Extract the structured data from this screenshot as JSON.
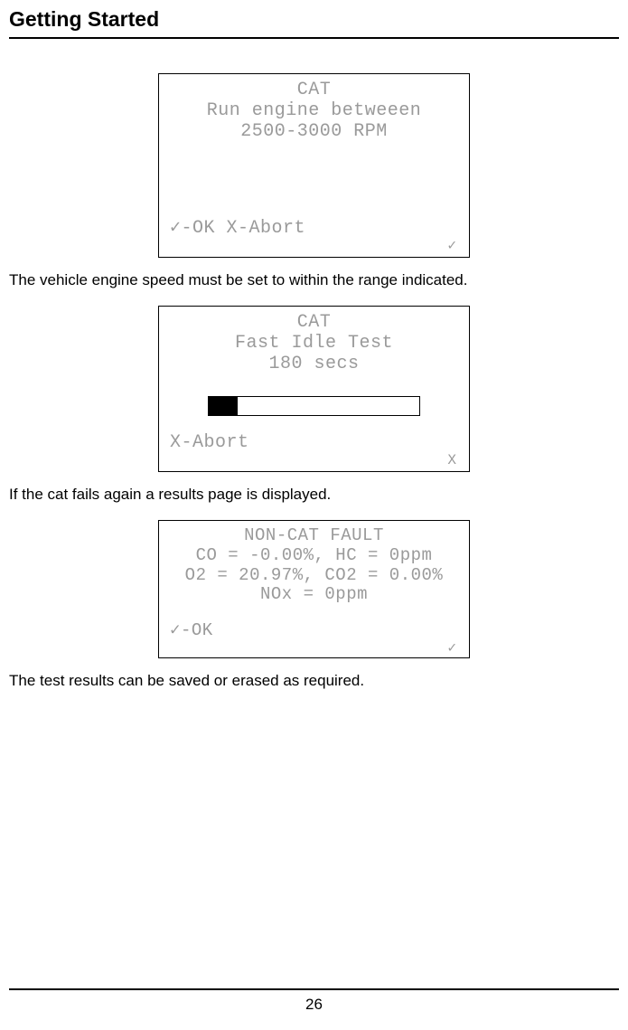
{
  "header": {
    "title": "Getting Started"
  },
  "screen1": {
    "title": "CAT",
    "line1": "Run engine betweeen",
    "line2": "2500-3000 RPM",
    "footer": "✓-OK X-Abort",
    "corner": "✓"
  },
  "para1": "The vehicle engine speed must be set to within the range indicated.",
  "screen2": {
    "title": "CAT",
    "line1": "Fast Idle Test",
    "line2": "180 secs",
    "footer": "X-Abort",
    "corner": "X"
  },
  "para2": "If the cat fails again a results page is displayed.",
  "screen3": {
    "title": "NON-CAT FAULT",
    "line1": "CO = -0.00%, HC = 0ppm",
    "line2": "O2 = 20.97%, CO2 = 0.00%",
    "line3": "NOx = 0ppm",
    "footer": "✓-OK",
    "corner": "✓"
  },
  "para3": "The test results can be saved or erased as required.",
  "page_number": "26"
}
